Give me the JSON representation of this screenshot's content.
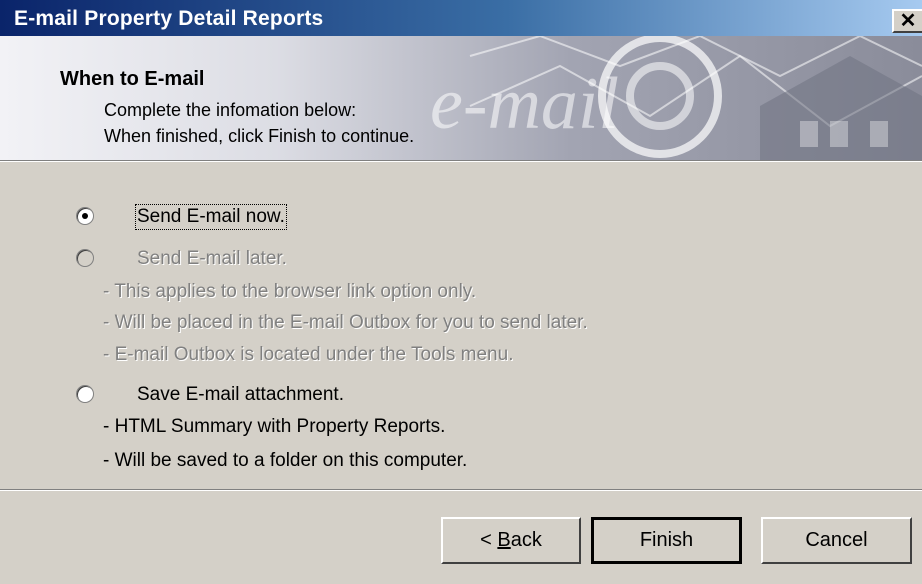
{
  "window": {
    "title": "E-mail Property Detail Reports",
    "close_symbol": "✕"
  },
  "banner": {
    "heading": "When to E-mail",
    "line1": "Complete the infomation below:",
    "line2": "When finished, click Finish to continue.",
    "watermark": "e-mail"
  },
  "options": [
    {
      "label": "Send E-mail now.",
      "selected": true,
      "enabled": true,
      "notes": []
    },
    {
      "label": "Send E-mail later.",
      "selected": false,
      "enabled": false,
      "notes": [
        "- This applies to the browser link option only.",
        "- Will be placed in the E-mail Outbox for you to send later.",
        "- E-mail Outbox is located under the Tools menu."
      ]
    },
    {
      "label": "Save E-mail attachment.",
      "selected": false,
      "enabled": true,
      "notes": [
        "- HTML Summary with Property Reports.",
        "- Will be saved to a folder on this computer."
      ]
    }
  ],
  "buttons": {
    "back_prefix": "< ",
    "back_mnemonic": "B",
    "back_rest": "ack",
    "finish": "Finish",
    "cancel": "Cancel"
  }
}
